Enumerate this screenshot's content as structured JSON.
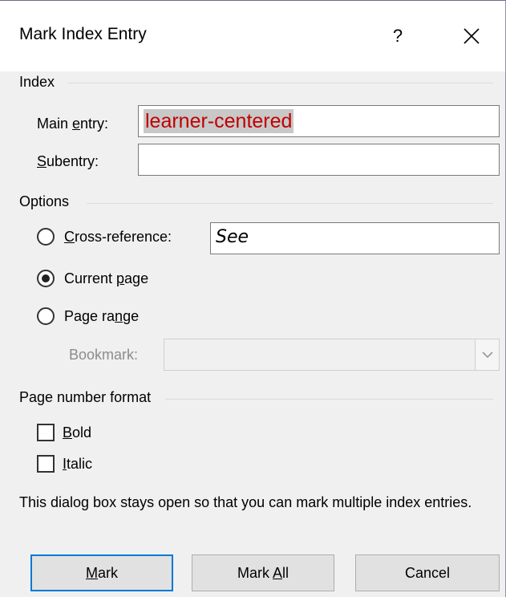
{
  "dialog": {
    "title": "Mark Index Entry",
    "help_label": "?",
    "close_icon": "close-icon"
  },
  "index_group": {
    "label": "Index",
    "main_entry": {
      "prefix": "Main ",
      "accel": "e",
      "suffix": "ntry:",
      "value": "learner-centered"
    },
    "subentry": {
      "accel": "S",
      "suffix": "ubentry:",
      "value": ""
    }
  },
  "options_group": {
    "label": "Options",
    "cross_reference": {
      "accel": "C",
      "suffix": "ross-reference:",
      "value": "See",
      "checked": false
    },
    "current_page": {
      "prefix": "Current ",
      "accel": "p",
      "suffix": "age",
      "checked": true
    },
    "page_range": {
      "prefix": "Page ra",
      "accel": "n",
      "suffix": "ge",
      "checked": false
    },
    "bookmark": {
      "label": "Bookmark:",
      "value": "",
      "dropdown_icon": "chevron-down-icon",
      "enabled": false
    }
  },
  "format_group": {
    "label": "Page number format",
    "bold": {
      "accel": "B",
      "suffix": "old",
      "checked": false
    },
    "italic": {
      "accel": "I",
      "suffix": "talic",
      "checked": false
    }
  },
  "info_text": "This dialog box stays open so that you can mark multiple index entries.",
  "buttons": {
    "mark": {
      "accel": "M",
      "suffix": "ark"
    },
    "mark_all": {
      "prefix": "Mark ",
      "accel": "A",
      "suffix": "ll"
    },
    "cancel": "Cancel"
  },
  "colors": {
    "accent": "#0078d7",
    "entry_text": "#c00000",
    "selection_bg": "#c8c8c8"
  }
}
